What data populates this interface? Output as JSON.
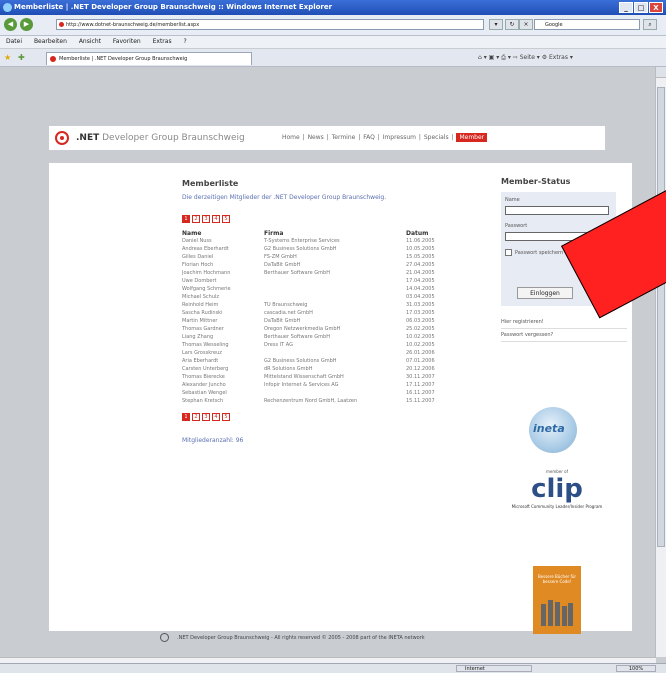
{
  "window": {
    "title": "Memberliste | .NET Developer Group Braunschweig :: Windows Internet Explorer",
    "controls": [
      "_",
      "□",
      "X"
    ]
  },
  "address": {
    "url": "http://www.dotnet-braunschweig.de/memberlist.aspx",
    "search_placeholder": "Google"
  },
  "menu": [
    "Datei",
    "Bearbeiten",
    "Ansicht",
    "Favoriten",
    "Extras",
    "?"
  ],
  "tab": {
    "label": "Memberliste | .NET Developer Group Braunschweig"
  },
  "toolbar_icons": "⌂ ▾ ▣ ▾ ⎙ ▾ ⇨ Seite ▾ ⚙ Extras ▾",
  "site": {
    "logo_bold": ".NET",
    "logo_rest": " Developer Group Braunschweig",
    "nav": [
      "Home",
      "News",
      "Termine",
      "FAQ",
      "Impressum",
      "Specials",
      "Member"
    ],
    "nav_active": "Member"
  },
  "memberlist": {
    "title": "Memberliste",
    "intro": "Die derzeitigen Mitglieder der .NET Developer Group Braunschweig.",
    "pages": [
      "1",
      "2",
      "3",
      "4",
      "5"
    ],
    "columns": [
      "Name",
      "Firma",
      "Datum"
    ],
    "rows": [
      [
        "Daniel Nuss",
        "T-Systems Enterprise Services",
        "11.06.2005"
      ],
      [
        "Andreas Eberhardt",
        "G2 Business Solutions GmbH",
        "10.05.2005"
      ],
      [
        "Gilles Daniel",
        "FS-ZM GmbH",
        "15.05.2005"
      ],
      [
        "Florian Hoch",
        "DaTaBit GmbH",
        "27.04.2005"
      ],
      [
        "Joachim Hochmann",
        "Berthauer Software GmbH",
        "21.04.2005"
      ],
      [
        "Uwe Dombert",
        "",
        "17.04.2005"
      ],
      [
        "Wolfgang Schmerie",
        "",
        "14.04.2005"
      ],
      [
        "Michael Schulz",
        "",
        "03.04.2005"
      ],
      [
        "Reinhold Heim",
        "TU Braunschweig",
        "31.03.2005"
      ],
      [
        "Sascha Rudinski",
        "cascadia.net GmbH",
        "17.03.2005"
      ],
      [
        "Martin Mittner",
        "DaTaBit GmbH",
        "06.03.2005"
      ],
      [
        "Thomas Gardner",
        "Oregon Netzwerkmedia GmbH",
        "25.02.2005"
      ],
      [
        "Liang Zhang",
        "Berthauer Software GmbH",
        "10.02.2005"
      ],
      [
        "Thomas Wesseling",
        "Dress IT AG",
        "10.02.2005"
      ],
      [
        "Lars Grosskreuz",
        "",
        "26.01.2006"
      ],
      [
        "Aria Eberhardt",
        "G2 Business Solutions GmbH",
        "07.01.2006"
      ],
      [
        "Carsten Unterberg",
        "dR Solutions GmbH",
        "20.12.2006"
      ],
      [
        "Thomas Bierecke",
        "Mittelstand Wissenschaft GmbH",
        "30.11.2007"
      ],
      [
        "Alexander Juncho",
        "Infopir Internet & Services AG",
        "17.11.2007"
      ],
      [
        "Sebastian Wengel",
        "",
        "16.11.2007"
      ],
      [
        "Stephan Kretsch",
        "Rechenzentrum Nord GmbH, Laatzen",
        "15.11.2007"
      ]
    ],
    "count_label": "Mitgliederanzahl: 96"
  },
  "member_status": {
    "title": "Member-Status",
    "user_label": "Name",
    "pass_label": "Passwort",
    "remember_label": "Passwort speichern",
    "login_button": "Einloggen",
    "links": [
      "Hier registrieren!",
      "Passwort vergessen?"
    ]
  },
  "sponsors": {
    "ineta": "ineta",
    "clip_super": "member of",
    "clip": "clip",
    "clip_sub": "Microsoft Community Leader/Insider Program",
    "ad_text": "Bessere Bücher für bessere Code!"
  },
  "footer": {
    "text": ".NET Developer Group Braunschweig - All rights reserved © 2005 - 2008 part of the INETA network"
  },
  "statusbar": {
    "zone": "Internet",
    "zoom": "100%"
  },
  "annotation_color": "#ff2020"
}
